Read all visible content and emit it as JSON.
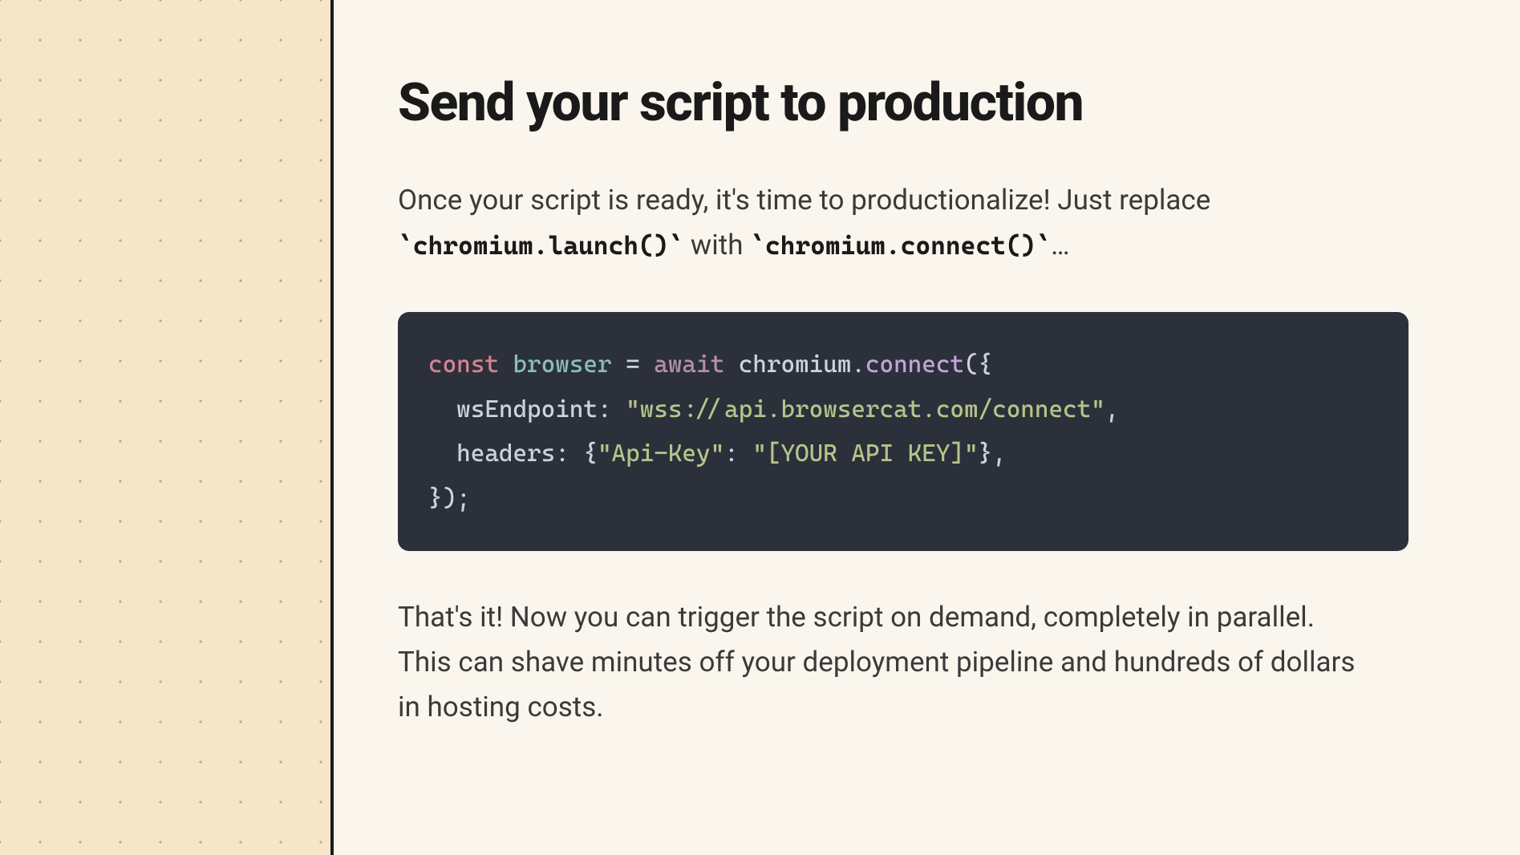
{
  "heading": "Send your script to production",
  "intro": {
    "part1": "Once your script is ready, it's time to productionalize! Just replace ",
    "code1": "`chromium.launch()`",
    "part2": " with ",
    "code2": "`chromium.connect()`",
    "part3": "…"
  },
  "code": {
    "line1": {
      "const": "const",
      "varname": "browser",
      "eq": " = ",
      "await": "await",
      "obj": " chromium.",
      "method": "connect",
      "open": "({"
    },
    "line2": {
      "indent": "  ",
      "prop": "wsEndpoint: ",
      "string": "\"wss://api.browsercat.com/connect\"",
      "comma": ","
    },
    "line3": {
      "indent": "  ",
      "prop": "headers: {",
      "key": "\"Api-Key\"",
      "colon": ": ",
      "val": "\"[YOUR API KEY]\"",
      "close": "},"
    },
    "line4": {
      "close": "});"
    }
  },
  "outro": "That's it! Now you can trigger the script on demand, completely in parallel. This can shave minutes off your deployment pipeline and hundreds of dollars in hosting costs."
}
